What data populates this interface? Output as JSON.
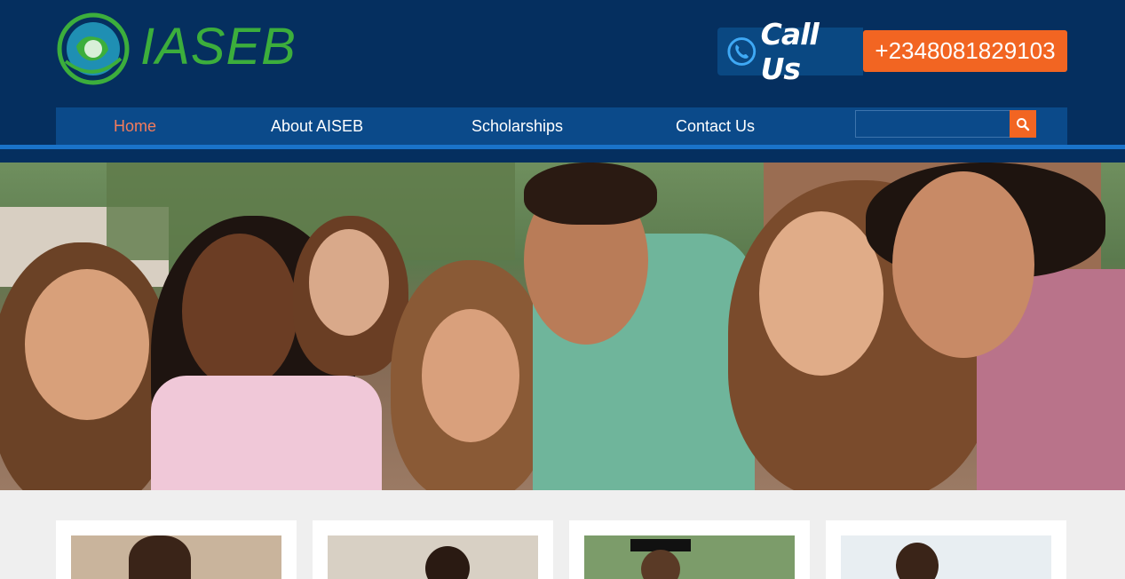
{
  "header": {
    "logo_text": "IASEB",
    "call_label": "Call Us",
    "phone_number": "+2348081829103"
  },
  "nav": {
    "items": [
      {
        "label": "Home",
        "active": true
      },
      {
        "label": "About AISEB",
        "active": false
      },
      {
        "label": "Scholarships",
        "active": false
      },
      {
        "label": "Contact Us",
        "active": false
      }
    ],
    "search": {
      "placeholder": "",
      "value": ""
    }
  },
  "hero": {
    "image": "group-of-smiling-students-photo"
  },
  "cards": [
    {
      "image": "student-portrait-1"
    },
    {
      "image": "student-portrait-2"
    },
    {
      "image": "graduate-portrait"
    },
    {
      "image": "student-portrait-4"
    }
  ],
  "colors": {
    "header_bg": "#052f5f",
    "nav_bg": "#0b4a8a",
    "accent_orange": "#f26522",
    "logo_green": "#3cae3c",
    "active_nav": "#f47c5c"
  }
}
